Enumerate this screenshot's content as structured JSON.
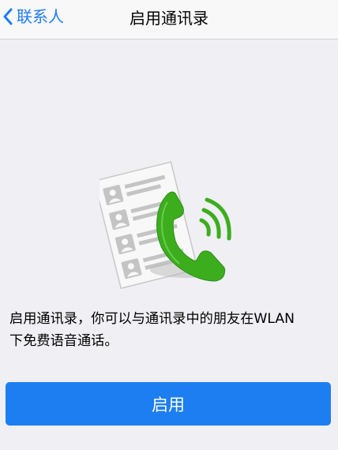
{
  "nav": {
    "back_label": "联系人",
    "title": "启用通讯录"
  },
  "content": {
    "description_line1": "启用通讯录，你可以与通讯录中的朋友在WLAN",
    "description_line2": "下免费语音通话。"
  },
  "actions": {
    "enable_label": "启用"
  },
  "colors": {
    "accent_blue": "#1f7cf6",
    "button_blue": "#1c7ef0",
    "phone_green": "#3cae1e",
    "background": "#efeff4"
  },
  "icons": {
    "back": "chevron-left-icon",
    "illustration": "contacts-phone-illustration"
  }
}
